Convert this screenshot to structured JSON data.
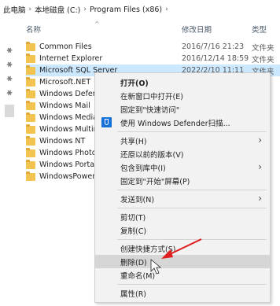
{
  "breadcrumb": [
    "此电脑",
    "本地磁盘 (C:)",
    "Program Files (x86)"
  ],
  "breadcrumb_sep": "›",
  "columns": {
    "name": "名称",
    "date": "修改日期",
    "type": "类型"
  },
  "files": [
    {
      "name": "Common Files",
      "date": "2016/7/16 21:23",
      "type": "文件夹"
    },
    {
      "name": "Internet Explorer",
      "date": "2016/12/14 18:59",
      "type": "文件夹"
    },
    {
      "name": "Microsoft SQL Server",
      "date": "2022/2/10 11:11",
      "type": "文件夹"
    },
    {
      "name": "Microsoft.NET",
      "date": "",
      "type": ""
    },
    {
      "name": "Windows Defender",
      "date": "",
      "type": ""
    },
    {
      "name": "Windows Mail",
      "date": "",
      "type": ""
    },
    {
      "name": "Windows Media Player",
      "date": "",
      "type": ""
    },
    {
      "name": "Windows Multimedia Platform",
      "date": "",
      "type": ""
    },
    {
      "name": "Windows NT",
      "date": "",
      "type": ""
    },
    {
      "name": "Windows Photo Viewer",
      "date": "",
      "type": ""
    },
    {
      "name": "Windows Portable Devices",
      "date": "",
      "type": ""
    },
    {
      "name": "WindowsPowerShell",
      "date": "",
      "type": ""
    }
  ],
  "menu": {
    "open": "打开(O)",
    "open_new_window": "在新窗口中打开(E)",
    "pin_quick_access": "固定到\"快速访问\"",
    "defender_scan": "使用 Windows Defender扫描...",
    "share": "共享(H)",
    "restore_previous": "还原以前的版本(V)",
    "include_library": "包含到库中(I)",
    "pin_start": "固定到\"开始\"屏幕(P)",
    "send_to": "发送到(N)",
    "cut": "剪切(T)",
    "copy": "复制(C)",
    "create_shortcut": "创建快捷方式(S)",
    "delete": "删除(D)",
    "rename": "重命名(M)",
    "properties": "属性(R)"
  },
  "submenu_arrow": "›",
  "colors": {
    "selection": "#cce8ff",
    "annotation_arrow": "#e02020",
    "defender_blue": "#1570d8"
  }
}
